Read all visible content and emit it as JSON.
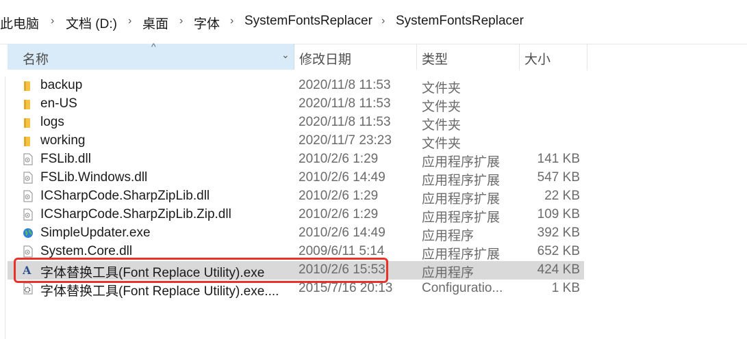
{
  "breadcrumb": [
    "此电脑",
    "文档 (D:)",
    "桌面",
    "字体",
    "SystemFontsReplacer",
    "SystemFontsReplacer"
  ],
  "columns": {
    "name": "名称",
    "date": "修改日期",
    "type": "类型",
    "size": "大小"
  },
  "files": [
    {
      "name": "backup",
      "date": "2020/11/8 11:53",
      "type": "文件夹",
      "size": "",
      "icon": "folder-icon"
    },
    {
      "name": "en-US",
      "date": "2020/11/8 11:53",
      "type": "文件夹",
      "size": "",
      "icon": "folder-icon"
    },
    {
      "name": "logs",
      "date": "2020/11/8 11:53",
      "type": "文件夹",
      "size": "",
      "icon": "folder-icon"
    },
    {
      "name": "working",
      "date": "2020/11/7 23:23",
      "type": "文件夹",
      "size": "",
      "icon": "folder-icon"
    },
    {
      "name": "FSLib.dll",
      "date": "2010/2/6 1:29",
      "type": "应用程序扩展",
      "size": "141 KB",
      "icon": "dll-file-icon"
    },
    {
      "name": "FSLib.Windows.dll",
      "date": "2010/2/6 14:49",
      "type": "应用程序扩展",
      "size": "547 KB",
      "icon": "dll-file-icon"
    },
    {
      "name": "ICSharpCode.SharpZipLib.dll",
      "date": "2010/2/6 1:29",
      "type": "应用程序扩展",
      "size": "22 KB",
      "icon": "dll-file-icon"
    },
    {
      "name": "ICSharpCode.SharpZipLib.Zip.dll",
      "date": "2010/2/6 1:29",
      "type": "应用程序扩展",
      "size": "109 KB",
      "icon": "dll-file-icon"
    },
    {
      "name": "SimpleUpdater.exe",
      "date": "2010/2/6 14:49",
      "type": "应用程序",
      "size": "392 KB",
      "icon": "globe-exe-icon"
    },
    {
      "name": "System.Core.dll",
      "date": "2009/6/11 5:14",
      "type": "应用程序扩展",
      "size": "652 KB",
      "icon": "dll-file-icon"
    },
    {
      "name": "字体替换工具(Font Replace Utility).exe",
      "date": "2010/2/6 15:53",
      "type": "应用程序",
      "size": "424 KB",
      "icon": "font-app-icon",
      "selected": true
    },
    {
      "name": "字体替换工具(Font Replace Utility).exe....",
      "date": "2015/7/16 20:13",
      "type": "Configuratio...",
      "size": "1 KB",
      "icon": "config-file-icon"
    }
  ],
  "colors": {
    "accent_header": "#d9ebf9",
    "selection": "#d9d9d9",
    "annotation": "#e8322b",
    "folder": "#f5c242"
  }
}
